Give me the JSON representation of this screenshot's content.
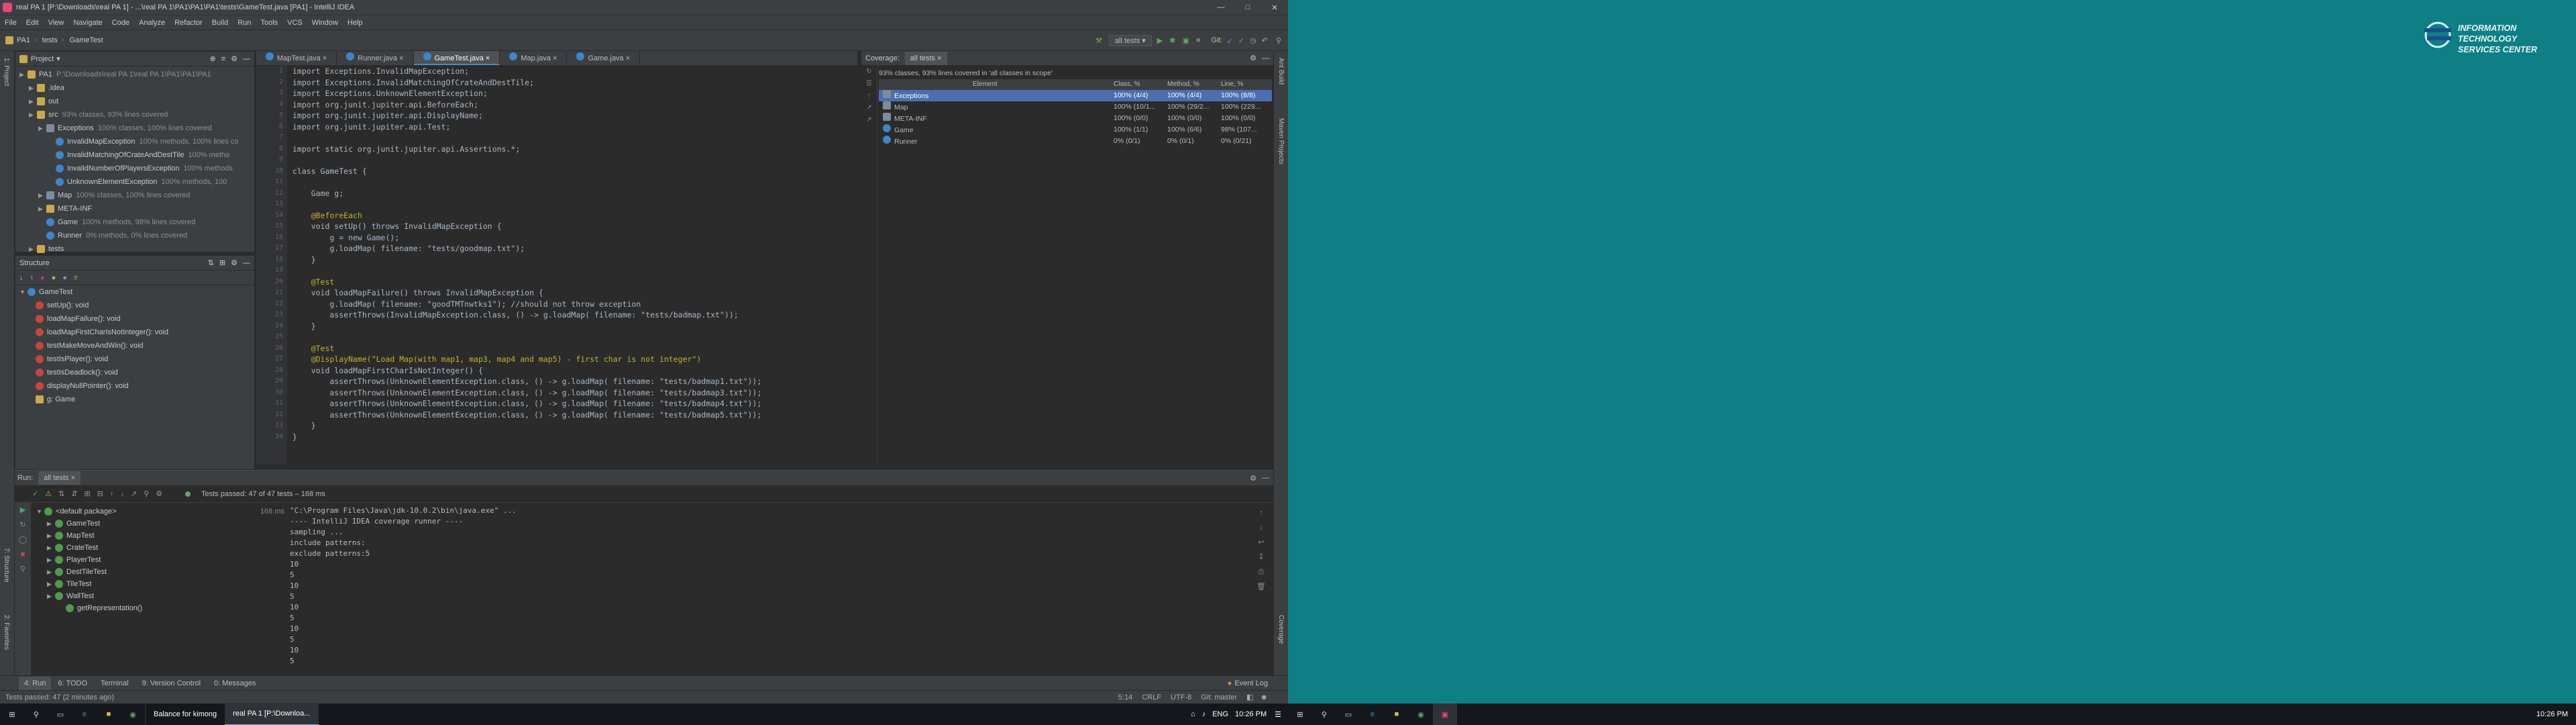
{
  "window": {
    "title": "real PA 1 [P:\\Downloads\\real PA 1] - ...\\real PA 1\\PA1\\PA1\\PA1\\tests\\GameTest.java [PA1] - IntelliJ IDEA"
  },
  "menu": [
    "File",
    "Edit",
    "View",
    "Navigate",
    "Code",
    "Analyze",
    "Refactor",
    "Build",
    "Run",
    "Tools",
    "VCS",
    "Window",
    "Help"
  ],
  "breadcrumbs": [
    "PA1",
    "tests",
    "GameTest"
  ],
  "run_config": "all tests",
  "git_label": "Git:",
  "project_panel": {
    "title": "Project",
    "items": [
      {
        "label": "PA1",
        "cov": "P:\\Downloads\\real PA 1\\real PA 1\\PA1\\PA1\\PA1",
        "indent": 0,
        "icon": "folder"
      },
      {
        "label": ".idea",
        "cov": "",
        "indent": 1,
        "icon": "folder"
      },
      {
        "label": "out",
        "cov": "",
        "indent": 1,
        "icon": "folder"
      },
      {
        "label": "src",
        "cov": "93% classes, 93% lines covered",
        "indent": 1,
        "icon": "folder"
      },
      {
        "label": "Exceptions",
        "cov": "100% classes, 100% lines covered",
        "indent": 2,
        "icon": "pkg"
      },
      {
        "label": "InvalidMapException",
        "cov": "100% methods, 100% lines co",
        "indent": 3,
        "icon": "cls"
      },
      {
        "label": "InvalidMatchingOfCrateAndDestTile",
        "cov": "100% metho",
        "indent": 3,
        "icon": "cls"
      },
      {
        "label": "InvalidNumberOfPlayersException",
        "cov": "100% methods",
        "indent": 3,
        "icon": "cls"
      },
      {
        "label": "UnknownElementException",
        "cov": "100% methods, 100",
        "indent": 3,
        "icon": "cls"
      },
      {
        "label": "Map",
        "cov": "100% classes, 100% lines covered",
        "indent": 2,
        "icon": "pkg"
      },
      {
        "label": "META-INF",
        "cov": "",
        "indent": 2,
        "icon": "folder"
      },
      {
        "label": "Game",
        "cov": "100% methods, 98% lines covered",
        "indent": 2,
        "icon": "cls"
      },
      {
        "label": "Runner",
        "cov": "0% methods, 0% lines covered",
        "indent": 2,
        "icon": "cls"
      },
      {
        "label": "tests",
        "cov": "",
        "indent": 1,
        "icon": "folder"
      }
    ]
  },
  "structure_panel": {
    "title": "Structure",
    "root": "GameTest",
    "items": [
      "setUp(): void",
      "loadMapFailure(): void",
      "loadMapFirstCharIsNotInteger(): void",
      "testMakeMoveAndWin(): void",
      "testIsPlayer(): void",
      "testIsDeadlock(): void",
      "displayNullPointer(): void",
      "g: Game"
    ]
  },
  "editor_tabs": [
    {
      "label": "MapTest.java",
      "active": false
    },
    {
      "label": "Runner.java",
      "active": false
    },
    {
      "label": "GameTest.java",
      "active": true
    },
    {
      "label": "Map.java",
      "active": false
    },
    {
      "label": "Game.java",
      "active": false
    }
  ],
  "code_lines": [
    "import Exceptions.InvalidMapException;",
    "import Exceptions.InvalidMatchingOfCrateAndDestTile;",
    "import Exceptions.UnknownElementException;",
    "import org.junit.jupiter.api.BeforeEach;",
    "import org.junit.jupiter.api.DisplayName;",
    "import org.junit.jupiter.api.Test;",
    "",
    "import static org.junit.jupiter.api.Assertions.*;",
    "",
    "class GameTest {",
    "",
    "    Game g;",
    "",
    "    @BeforeEach",
    "    void setUp() throws InvalidMapException {",
    "        g = new Game();",
    "        g.loadMap( filename: \"tests/goodmap.txt\");",
    "    }",
    "",
    "    @Test",
    "    void loadMapFailure() throws InvalidMapException {",
    "        g.loadMap( filename: \"goodTMTnwtks1\"); //should not throw exception",
    "        assertThrows(InvalidMapException.class, () -> g.loadMap( filename: \"tests/badmap.txt\"));",
    "    }",
    "",
    "    @Test",
    "    @DisplayName(\"Load Map(with map1, map3, map4 and map5) - first char is not integer\")",
    "    void loadMapFirstCharIsNotInteger() {",
    "        assertThrows(UnknownElementException.class, () -> g.loadMap( filename: \"tests/badmap1.txt\"));",
    "        assertThrows(UnknownElementException.class, () -> g.loadMap( filename: \"tests/badmap3.txt\"));",
    "        assertThrows(UnknownElementException.class, () -> g.loadMap( filename: \"tests/badmap4.txt\"));",
    "        assertThrows(UnknownElementException.class, () -> g.loadMap( filename: \"tests/badmap5.txt\"));",
    "    }",
    "}"
  ],
  "coverage": {
    "tab_label": "Coverage:",
    "suite": "all tests",
    "summary": "93% classes, 93% lines covered in 'all classes in scope'",
    "headers": [
      "Element",
      "Class, %",
      "Method, %",
      "Line, %"
    ],
    "rows": [
      {
        "name": "Exceptions",
        "cls": "100% (4/4)",
        "meth": "100% (4/4)",
        "line": "100% (8/8)",
        "selected": true
      },
      {
        "name": "Map",
        "cls": "100% (10/1...",
        "meth": "100% (29/2...",
        "line": "100% (229...",
        "selected": false
      },
      {
        "name": "META-INF",
        "cls": "100% (0/0)",
        "meth": "100% (0/0)",
        "line": "100% (0/0)",
        "selected": false
      },
      {
        "name": "Game",
        "cls": "100% (1/1)",
        "meth": "100% (6/6)",
        "line": "98% (107...",
        "selected": false
      },
      {
        "name": "Runner",
        "cls": "0% (0/1)",
        "meth": "0% (0/1)",
        "line": "0% (0/21)",
        "selected": false
      }
    ]
  },
  "run": {
    "label": "Run:",
    "config": "all tests",
    "status": "Tests passed: 47 of 47 tests – 168 ms",
    "tree": [
      {
        "label": "<default package>",
        "time": "168 ms",
        "indent": 0
      },
      {
        "label": "GameTest",
        "time": "",
        "indent": 1
      },
      {
        "label": "MapTest",
        "time": "",
        "indent": 1
      },
      {
        "label": "CrateTest",
        "time": "",
        "indent": 1
      },
      {
        "label": "PlayerTest",
        "time": "",
        "indent": 1
      },
      {
        "label": "DestTileTest",
        "time": "",
        "indent": 1
      },
      {
        "label": "TileTest",
        "time": "",
        "indent": 1
      },
      {
        "label": "WallTest",
        "time": "",
        "indent": 1
      },
      {
        "label": "getRepresentation()",
        "time": "",
        "indent": 2
      }
    ],
    "console": [
      "\"C:\\Program Files\\Java\\jdk-10.0.2\\bin\\java.exe\" ...",
      "---- IntelliJ IDEA coverage runner ----",
      "sampling ...",
      "include patterns:",
      "exclude patterns:5",
      "10",
      "5",
      "10",
      "5",
      "10",
      "5",
      "10",
      "5",
      "10",
      "5"
    ]
  },
  "bottom_tabs": [
    "4: Run",
    "6: TODO",
    "Terminal",
    "9: Version Control",
    "0: Messages"
  ],
  "event_log": "Event Log",
  "status": {
    "left": "Tests passed: 47 (2 minutes ago)",
    "pos": "5:14",
    "crlf": "CRLF",
    "enc": "UTF-8",
    "git": "Git: master"
  },
  "taskbar": {
    "items": [
      "Balance for kimong",
      "real PA 1 [P:\\Downloa..."
    ],
    "lang": "ENG",
    "time": "10:26 PM"
  },
  "desktop2": {
    "logo_text": "ITSC",
    "line1": "INFORMATION TECHNOLOGY",
    "line2": "SERVICES CENTER",
    "time": "10:26 PM"
  }
}
